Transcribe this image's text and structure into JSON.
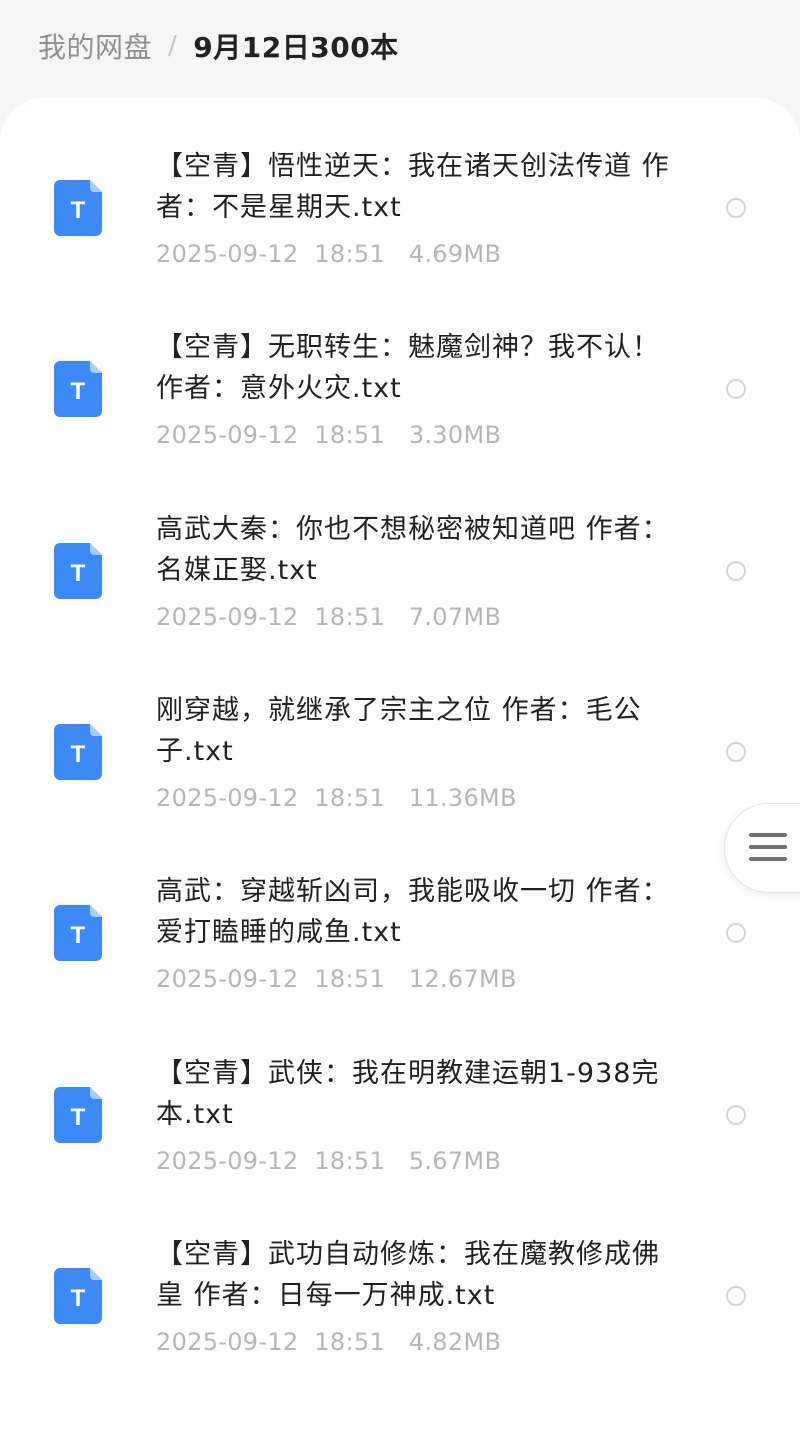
{
  "breadcrumb": {
    "root": "我的网盘",
    "separator": "/",
    "current": "9月12日300本"
  },
  "files": [
    {
      "name": "【空青】悟性逆天：我在诸天创法传道 作者：不是星期天.txt",
      "date": "2025-09-12",
      "time": "18:51",
      "size": "4.69MB",
      "icon": "txt-file-icon"
    },
    {
      "name": "【空青】无职转生：魅魔剑神？我不认！ 作者：意外火灾.txt",
      "date": "2025-09-12",
      "time": "18:51",
      "size": "3.30MB",
      "icon": "txt-file-icon"
    },
    {
      "name": "高武大秦：你也不想秘密被知道吧 作者：名媒正娶.txt",
      "date": "2025-09-12",
      "time": "18:51",
      "size": "7.07MB",
      "icon": "txt-file-icon"
    },
    {
      "name": "刚穿越，就继承了宗主之位 作者：毛公子.txt",
      "date": "2025-09-12",
      "time": "18:51",
      "size": "11.36MB",
      "icon": "txt-file-icon"
    },
    {
      "name": "高武：穿越斩凶司，我能吸收一切 作者：爱打瞌睡的咸鱼.txt",
      "date": "2025-09-12",
      "time": "18:51",
      "size": "12.67MB",
      "icon": "txt-file-icon"
    },
    {
      "name": "【空青】武侠：我在明教建运朝1-938完本.txt",
      "date": "2025-09-12",
      "time": "18:51",
      "size": "5.67MB",
      "icon": "txt-file-icon"
    },
    {
      "name": "【空青】武功自动修炼：我在魔教修成佛皇 作者：日每一万神成.txt",
      "date": "2025-09-12",
      "time": "18:51",
      "size": "4.82MB",
      "icon": "txt-file-icon"
    }
  ],
  "icon_letter": "T",
  "colors": {
    "icon_blue": "#3d8af7",
    "icon_fold": "#a9ccfb",
    "radio_border": "#d2d4d9",
    "meta_text": "#b3b6bd"
  },
  "floating_menu": {
    "icon": "hamburger-menu-icon"
  }
}
